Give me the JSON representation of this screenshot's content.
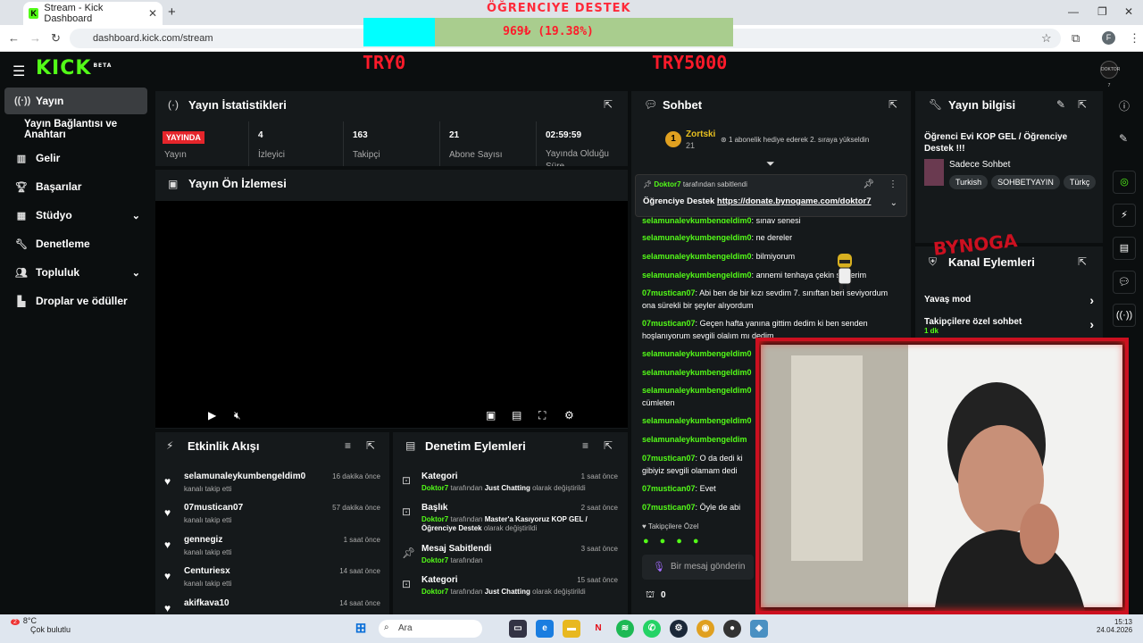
{
  "browser": {
    "tab_title": "Stream - Kick Dashboard",
    "url": "dashboard.kick.com/stream",
    "profile_initial": "F"
  },
  "overlay": {
    "goal_title": "ÖĞRENCIYE DESTEK",
    "goal_value": "969₺ (19.38%)",
    "goal_progress": 0.1938,
    "left_label": "TRY0",
    "right_label": "TRY5000",
    "sponsor": "BYNOGA"
  },
  "header": {
    "logo": "KICK",
    "beta": "BETA",
    "profile_text": "DOKTOR 7"
  },
  "sidebar": {
    "items": [
      {
        "label": "Yayın",
        "icon": "broadcast-icon"
      },
      {
        "label": "Yayın Bağlantısı ve Anahtarı",
        "icon": ""
      },
      {
        "label": "Gelir",
        "icon": "bar-chart-icon"
      },
      {
        "label": "Başarılar",
        "icon": "trophy-icon"
      },
      {
        "label": "Stüdyo",
        "icon": "studio-icon"
      },
      {
        "label": "Denetleme",
        "icon": "wrench-icon"
      },
      {
        "label": "Topluluk",
        "icon": "community-icon"
      },
      {
        "label": "Droplar ve ödüller",
        "icon": "drops-icon"
      }
    ]
  },
  "stats": {
    "title": "Yayın İstatistikleri",
    "live_badge": "YAYINDA",
    "items": [
      {
        "value": "",
        "label": "Yayın"
      },
      {
        "value": "4",
        "label": "İzleyici"
      },
      {
        "value": "163",
        "label": "Takipçi"
      },
      {
        "value": "21",
        "label": "Abone Sayısı"
      },
      {
        "value": "02:59:59",
        "label": "Yayında Olduğu Süre"
      }
    ]
  },
  "preview": {
    "title": "Yayın Ön İzlemesi"
  },
  "activity": {
    "title": "Etkinlik Akışı",
    "rows": [
      {
        "name": "selamunaleykumbengeldim0",
        "sub": "kanalı takip etti",
        "time": "16 dakika önce"
      },
      {
        "name": "07mustican07",
        "sub": "kanalı takip etti",
        "time": "57 dakika önce"
      },
      {
        "name": "gennegiz",
        "sub": "kanalı takip etti",
        "time": "1 saat önce"
      },
      {
        "name": "Centuriesx",
        "sub": "kanalı takip etti",
        "time": "14 saat önce"
      },
      {
        "name": "akifkava10",
        "sub": "",
        "time": "14 saat önce"
      }
    ]
  },
  "moderation": {
    "title": "Denetim Eylemleri",
    "rows": [
      {
        "name": "Kategori",
        "time": "1 saat önce",
        "user": "Doktor7",
        "pre": "tarafından",
        "obj": "Just Chatting",
        "post": "olarak değiştirildi"
      },
      {
        "name": "Başlık",
        "time": "2 saat önce",
        "user": "Doktor7",
        "pre": "tarafından",
        "obj": "Master'a Kasıyoruz KOP GEL / Öğrenciye Destek",
        "post": "olarak değiştirildi"
      },
      {
        "name": "Mesaj Sabitlendi",
        "time": "3 saat önce",
        "user": "Doktor7",
        "pre": "tarafından",
        "obj": "",
        "post": ""
      },
      {
        "name": "Kategori",
        "time": "15 saat önce",
        "user": "Doktor7",
        "pre": "tarafından",
        "obj": "Just Chatting",
        "post": "olarak değiştirildi"
      }
    ]
  },
  "chat": {
    "title": "Sohbet",
    "top_gifter": {
      "rank": "1",
      "name": "Zortski",
      "count": "21",
      "text": "1 abonelik hediye ederek 2. sıraya yükseldin"
    },
    "pinned": {
      "user": "Doktor7",
      "by": "tarafından sabitlendi",
      "text": "Öğrenciye Destek",
      "link": "https://donate.bynogame.com/doktor7"
    },
    "messages": [
      {
        "user": "selamunaleykumbengeldim0",
        "text": "sınav senesi"
      },
      {
        "user": "selamunaleykumbengeldim0",
        "text": "ne dereler"
      },
      {
        "user": "selamunaleykumbengeldim0",
        "text": "bilmiyorum"
      },
      {
        "user": "selamunaleykumbengeldim0",
        "text": "annemi tenhaya çekin söylerim"
      },
      {
        "user": "07mustican07",
        "text": "Abi ben de bir kızı sevdim 7. sınıftan beri seviyordum ona sürekli bir şeyler alıyordum"
      },
      {
        "user": "07mustican07",
        "text": "Geçen hafta yanına gittim dedim ki ben senden hoşlanıyorum sevgili olalım mı dedim"
      },
      {
        "user": "selamunaleykumbengeldim0",
        "text": ""
      },
      {
        "user": "selamunaleykumbengeldim0",
        "text": ""
      },
      {
        "user": "selamunaleykumbengeldim0",
        "text": "cümleten"
      },
      {
        "user": "selamunaleykumbengeldim0",
        "text": ""
      },
      {
        "user": "selamunaleykumbengeldim",
        "text": ""
      },
      {
        "user": "07mustican07",
        "text": "O da dedi ki gibiyiz sevgili olamam dedi"
      },
      {
        "user": "07mustican07",
        "text": "Evet"
      },
      {
        "user": "07mustican07",
        "text": "Öyle de abi"
      }
    ],
    "followers_only": "Takipçilere Özel",
    "input_placeholder": "Bir mesaj gönderin",
    "points": "0"
  },
  "streaminfo": {
    "title": "Yayın bilgisi",
    "stream_title": "Öğrenci Evi KOP GEL / Öğrenciye Destek !!!",
    "category": "Sadece Sohbet",
    "tags": [
      "Turkish",
      "SOHBETYAYIN",
      "Türkç"
    ]
  },
  "channel_actions": {
    "title": "Kanal Eylemleri",
    "items": [
      {
        "label": "Yavaş mod",
        "sub": ""
      },
      {
        "label": "Takipçilere özel sohbet",
        "sub": "1 dk"
      }
    ]
  },
  "taskbar": {
    "temp": "8°C",
    "weather": "Çok bulutlu",
    "search": "Ara",
    "time": "15:13",
    "date": "24.04.2026",
    "notif": "2"
  },
  "colors": {
    "accent": "#53fc18",
    "live": "#e5252b",
    "overlay_red": "#ff1a2a",
    "overlay_fill": "#00ffff"
  }
}
